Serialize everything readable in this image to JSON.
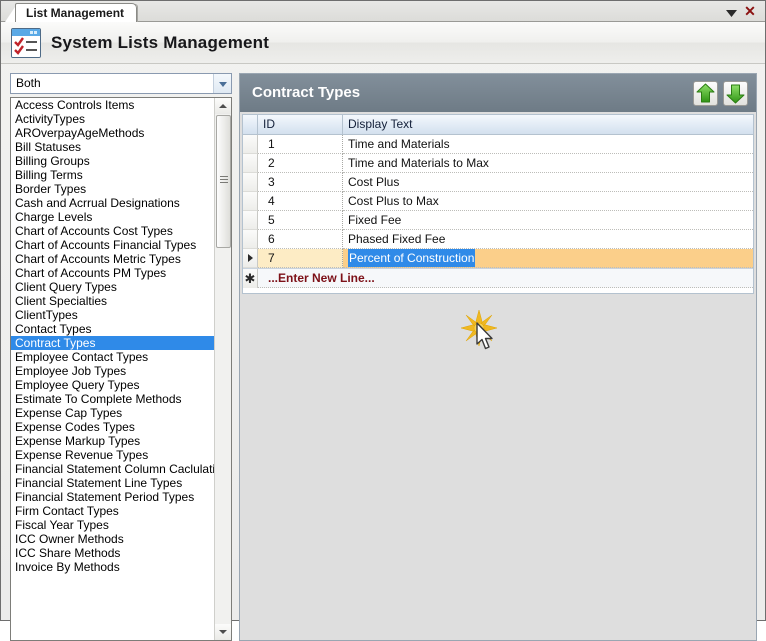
{
  "window": {
    "tab_label": "List Management",
    "dropdown_icon": "chevron-down-icon",
    "close_icon": "close-icon",
    "close_glyph": "✕"
  },
  "titlebar": {
    "title": "System Lists Management",
    "icon": "checklist-window-icon"
  },
  "left": {
    "filter": {
      "value": "Both",
      "options": [
        "Both"
      ],
      "dropdown_icon": "chevron-down-icon"
    },
    "list_label": "system-lists",
    "selected": "Contract Types",
    "items": [
      "Access Controls Items",
      "ActivityTypes",
      "AROverpayAgeMethods",
      "Bill Statuses",
      "Billing Groups",
      "Billing Terms",
      "Border Types",
      "Cash and Acrrual Designations",
      "Charge Levels",
      "Chart of Accounts Cost Types",
      "Chart of Accounts Financial Types",
      "Chart of Accounts Metric Types",
      "Chart of Accounts PM Types",
      "Client Query Types",
      "Client Specialties",
      "ClientTypes",
      "Contact Types",
      "Contract Types",
      "Employee Contact Types",
      "Employee Job Types",
      "Employee Query Types",
      "Estimate To Complete Methods",
      "Expense Cap Types",
      "Expense Codes Types",
      "Expense Markup Types",
      "Expense Revenue Types",
      "Financial Statement Column Caclulation Ty",
      "Financial Statement Line Types",
      "Financial Statement Period Types",
      "Firm Contact Types",
      "Fiscal Year Types",
      "ICC Owner Methods",
      "ICC Share Methods",
      "Invoice By Methods"
    ],
    "scrollbar": {
      "up_icon": "scroll-up-arrow-icon",
      "down_icon": "scroll-down-arrow-icon",
      "thumb_icon": "scroll-thumb-grip"
    }
  },
  "panel": {
    "title": "Contract Types",
    "move_up_label": "Move Up",
    "move_up_icon": "arrow-up-icon",
    "move_down_label": "Move Down",
    "move_down_icon": "arrow-down-icon",
    "grid": {
      "columns": [
        "ID",
        "Display Text"
      ],
      "rows": [
        {
          "id": "1",
          "text": "Time and Materials"
        },
        {
          "id": "2",
          "text": "Time and Materials to Max"
        },
        {
          "id": "3",
          "text": "Cost Plus"
        },
        {
          "id": "4",
          "text": "Cost Plus to Max"
        },
        {
          "id": "5",
          "text": "Fixed Fee"
        },
        {
          "id": "6",
          "text": "Phased Fixed Fee"
        },
        {
          "id": "7",
          "text": "Percent of Construction"
        }
      ],
      "selected_row_index": 6,
      "editing_text": "Percent of Construction",
      "new_row_label": "...Enter New Line...",
      "new_row_glyph": "✱",
      "row_caret_icon": "row-selector-caret-icon"
    }
  },
  "cursor": {
    "burst_icon": "click-burst-icon",
    "pointer_icon": "mouse-pointer-icon"
  },
  "colors": {
    "panel_header": "#77848f",
    "selection_blue": "#2f8ae8",
    "row_highlight": "#fbcf8a",
    "new_row_text": "#7d1118",
    "close_red": "#8b1111",
    "arrow_green": "#3faa23"
  }
}
